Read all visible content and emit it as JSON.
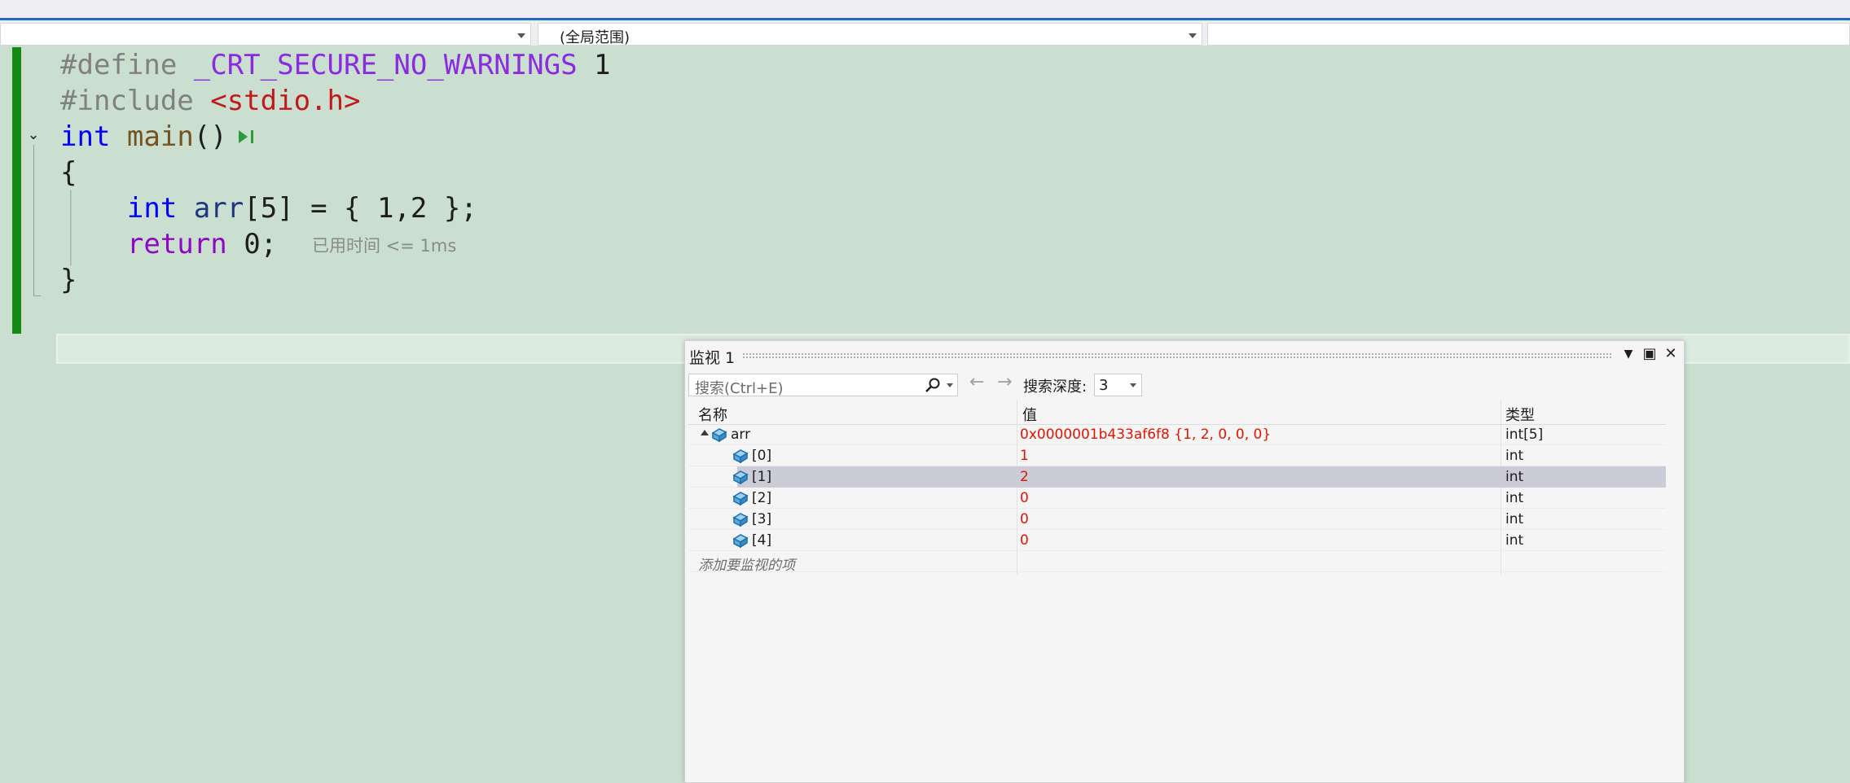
{
  "navbar": {
    "project_combo": "",
    "scope_combo": "(全局范围)",
    "member_combo": ""
  },
  "editor": {
    "lines": [
      {
        "tokens": [
          {
            "t": "#define ",
            "c": "gray"
          },
          {
            "t": "_CRT_SECURE_NO_WARNINGS",
            "c": "macro"
          },
          {
            "t": " 1",
            "c": "plain"
          }
        ]
      },
      {
        "tokens": [
          {
            "t": "#include ",
            "c": "gray"
          },
          {
            "t": "<stdio.h>",
            "c": "str"
          }
        ]
      },
      {
        "tokens": [
          {
            "t": "int",
            "c": "type"
          },
          {
            "t": " ",
            "c": "plain"
          },
          {
            "t": "main",
            "c": "fn"
          },
          {
            "t": "()",
            "c": "plain"
          }
        ]
      },
      {
        "tokens": [
          {
            "t": "{",
            "c": "plain"
          }
        ]
      },
      {
        "tokens": [
          {
            "t": "    ",
            "c": "plain"
          },
          {
            "t": "int",
            "c": "type"
          },
          {
            "t": " ",
            "c": "plain"
          },
          {
            "t": "arr",
            "c": "var"
          },
          {
            "t": "[5] = { 1,2 };",
            "c": "plain"
          }
        ]
      },
      {
        "tokens": [
          {
            "t": "    ",
            "c": "plain"
          },
          {
            "t": "return",
            "c": "ret"
          },
          {
            "t": " 0;",
            "c": "plain"
          }
        ]
      },
      {
        "tokens": [
          {
            "t": "}",
            "c": "plain"
          }
        ]
      }
    ],
    "perf_tip": "已用时间 <= 1ms",
    "colors": {
      "gray": "#808080",
      "macro": "#8a2be2",
      "str": "#c21a1a",
      "type": "#0000ff",
      "fn": "#74531f",
      "var": "#1f377f",
      "ret": "#8f08c4",
      "plain": "#1e1e1e"
    }
  },
  "watch": {
    "title": "监视 1",
    "search_placeholder": "搜索(Ctrl+E)",
    "depth_label": "搜索深度:",
    "depth_value": "3",
    "columns": {
      "name": "名称",
      "value": "值",
      "type": "类型"
    },
    "rows": [
      {
        "name": "arr",
        "value": "0x0000001b433af6f8 {1, 2, 0, 0, 0}",
        "type": "int[5]",
        "level": 0,
        "expanded": true,
        "selected": false
      },
      {
        "name": "[0]",
        "value": "1",
        "type": "int",
        "level": 1,
        "selected": false
      },
      {
        "name": "[1]",
        "value": "2",
        "type": "int",
        "level": 1,
        "selected": true
      },
      {
        "name": "[2]",
        "value": "0",
        "type": "int",
        "level": 1,
        "selected": false
      },
      {
        "name": "[3]",
        "value": "0",
        "type": "int",
        "level": 1,
        "selected": false
      },
      {
        "name": "[4]",
        "value": "0",
        "type": "int",
        "level": 1,
        "selected": false
      }
    ],
    "add_item_placeholder": "添加要监视的项"
  }
}
